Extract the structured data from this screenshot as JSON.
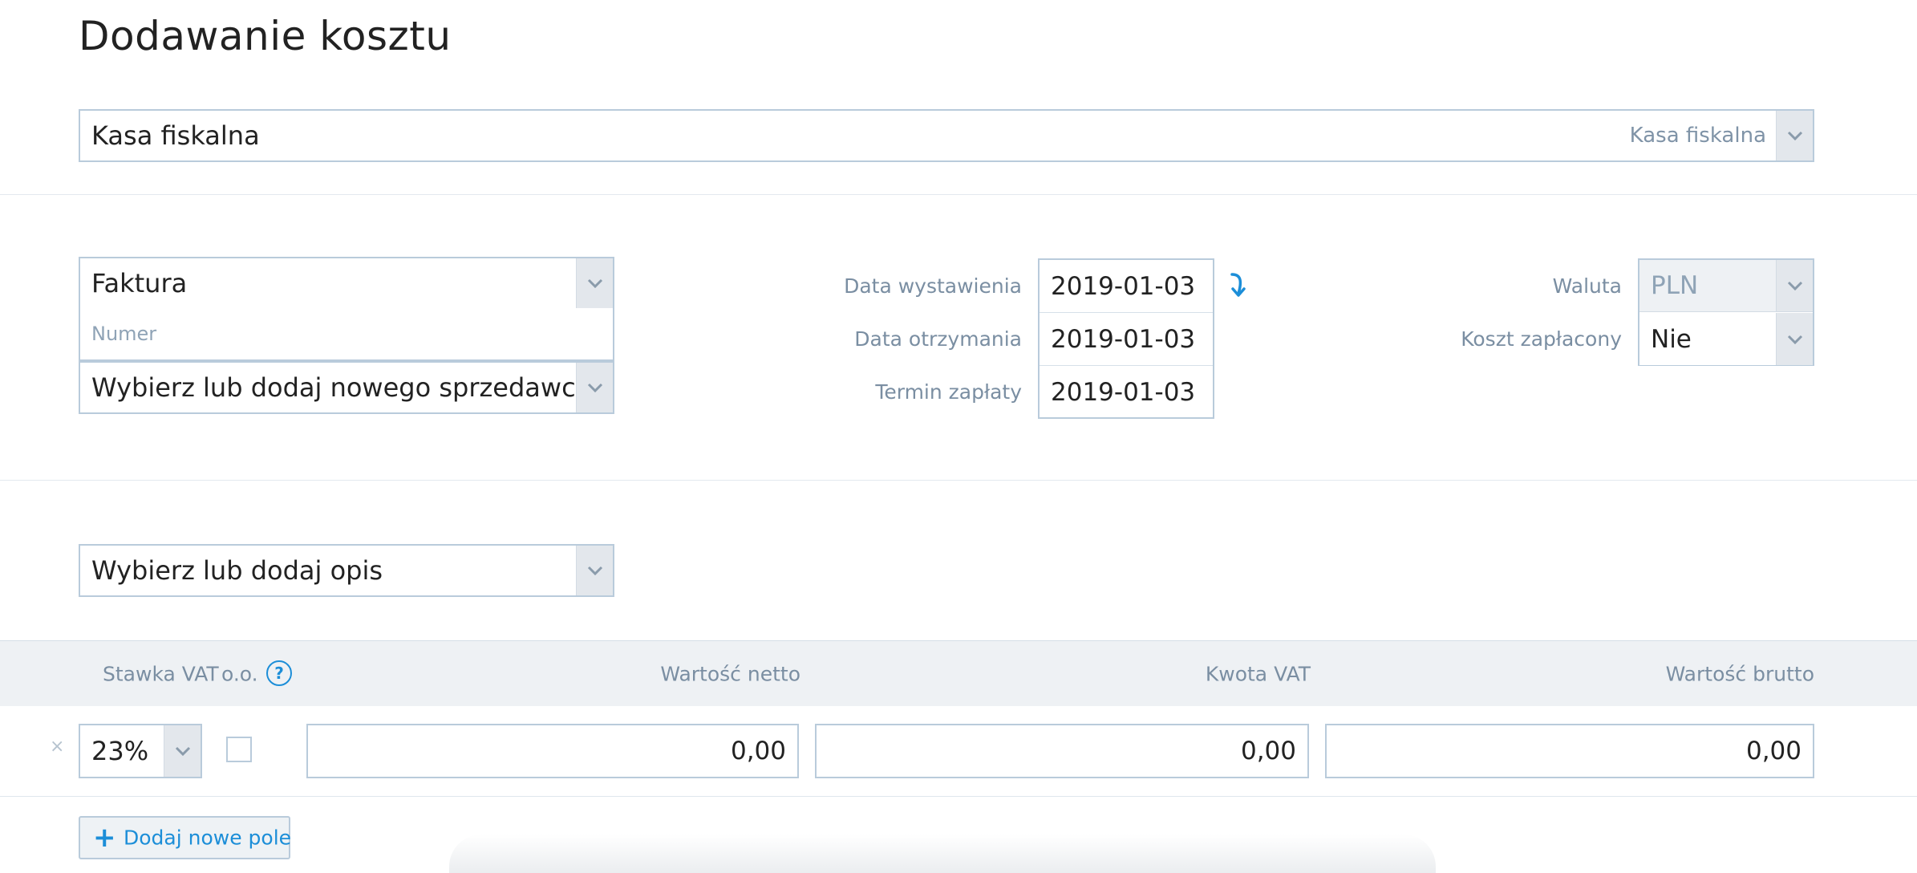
{
  "page": {
    "title": "Dodawanie kosztu"
  },
  "category": {
    "value": "Kasa fiskalna",
    "hint": "Kasa fiskalna"
  },
  "document": {
    "type": "Faktura",
    "number_placeholder": "Numer",
    "seller_placeholder": "Wybierz lub dodaj nowego sprzedawcę"
  },
  "dates": {
    "issue_label": "Data wystawienia",
    "issue_value": "2019-01-03",
    "received_label": "Data otrzymania",
    "received_value": "2019-01-03",
    "due_label": "Termin zapłaty",
    "due_value": "2019-01-03"
  },
  "payment": {
    "currency_label": "Waluta",
    "currency_value": "PLN",
    "paid_label": "Koszt zapłacony",
    "paid_value": "Nie"
  },
  "description": {
    "placeholder": "Wybierz lub dodaj opis"
  },
  "vat_table": {
    "headers": {
      "rate": "Stawka VAT",
      "oo": "o.o.",
      "help": "?",
      "net": "Wartość netto",
      "vat": "Kwota VAT",
      "gross": "Wartość brutto"
    },
    "rows": [
      {
        "remove": "×",
        "rate": "23%",
        "net": "0,00",
        "vat": "0,00",
        "gross": "0,00"
      }
    ]
  },
  "add_button": {
    "plus": "+",
    "label": "Dodaj nowe pole"
  },
  "colors": {
    "accent": "#1c8ed8",
    "border": "#b9cbdb",
    "muted": "#7a8ea2",
    "header_bg": "#eef1f4"
  }
}
